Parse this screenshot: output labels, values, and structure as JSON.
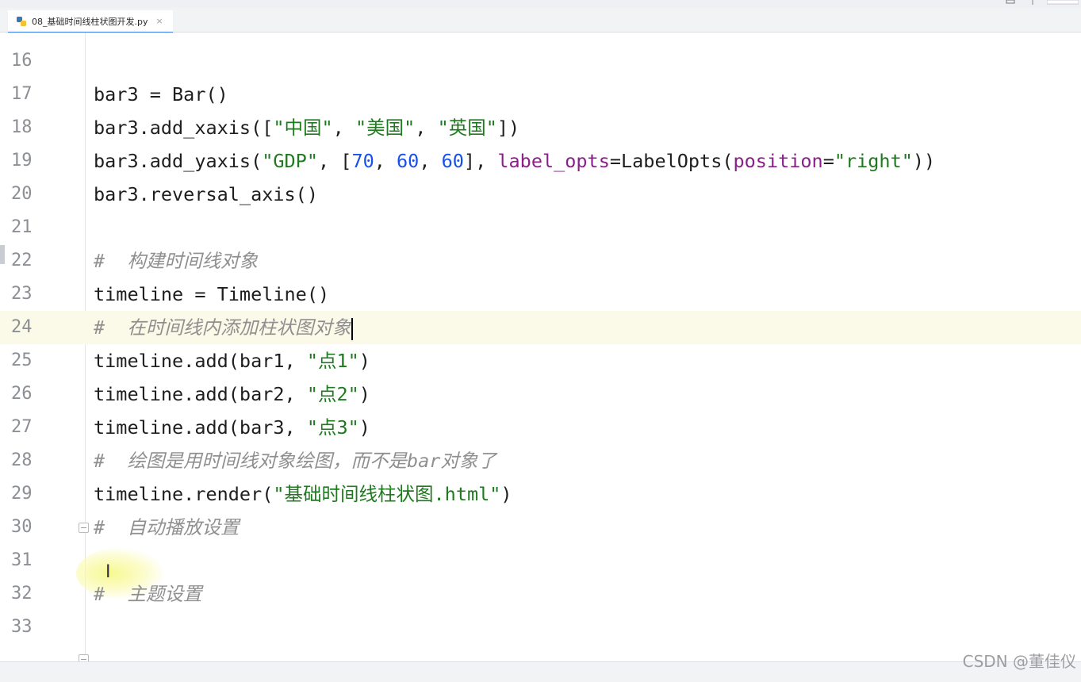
{
  "tab": {
    "filename": "08_基础时间线柱状图开发.py",
    "close": "×"
  },
  "gutter": {
    "lines": [
      "16",
      "17",
      "18",
      "19",
      "20",
      "21",
      "22",
      "23",
      "24",
      "25",
      "26",
      "27",
      "28",
      "29",
      "30",
      "31",
      "32",
      "33"
    ]
  },
  "code": {
    "l17": {
      "a": "bar3 = Bar()"
    },
    "l18": {
      "a": "bar3.add_xaxis([",
      "s1": "\"中国\"",
      "c1": ", ",
      "s2": "\"美国\"",
      "c2": ", ",
      "s3": "\"英国\"",
      "b": "])"
    },
    "l19": {
      "a": "bar3.add_yaxis(",
      "s1": "\"GDP\"",
      "c1": ", [",
      "n1": "70",
      "c2": ", ",
      "n2": "60",
      "c3": ", ",
      "n3": "60",
      "c4": "], ",
      "k1": "label_opts",
      "c5": "=LabelOpts(",
      "k2": "position",
      "c6": "=",
      "s2": "\"right\"",
      "b": "))"
    },
    "l20": {
      "a": "bar3.reversal_axis()"
    },
    "l22": {
      "cm": "#  构建时间线对象"
    },
    "l23": {
      "a": "timeline = Timeline()"
    },
    "l24": {
      "cm": "#  在时间线内添加柱状图对象"
    },
    "l25": {
      "a": "timeline.add(bar1, ",
      "s": "\"点1\"",
      "b": ")"
    },
    "l26": {
      "a": "timeline.add(bar2, ",
      "s": "\"点2\"",
      "b": ")"
    },
    "l27": {
      "a": "timeline.add(bar3, ",
      "s": "\"点3\"",
      "b": ")"
    },
    "l28": {
      "cm": "#  绘图是用时间线对象绘图，而不是bar对象了"
    },
    "l29": {
      "a": "timeline.render(",
      "s": "\"基础时间线柱状图.html\"",
      "b": ")"
    },
    "l30": {
      "cm": "#  自动播放设置"
    },
    "l32": {
      "cm": "#  主题设置"
    }
  },
  "cursor": {
    "glyph": "I"
  },
  "watermark": "CSDN @董佳仪",
  "colors": {
    "string": "#1f7a1f",
    "number": "#1750eb",
    "keyword_arg": "#8a1f8a",
    "comment": "#8f8f8f",
    "current_line": "#fbfae8",
    "tab_underline": "#3574f0"
  }
}
